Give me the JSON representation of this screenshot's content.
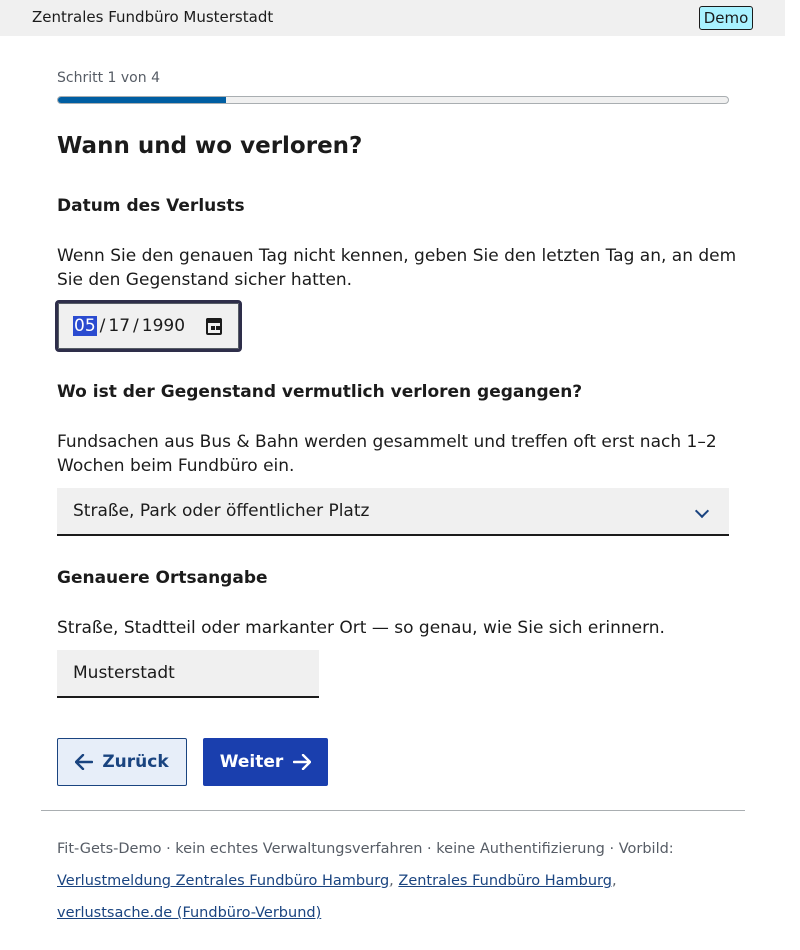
{
  "header": {
    "org_name": "Zentrales Fundbüro Musterstadt",
    "badge": "Demo"
  },
  "progress": {
    "step_text": "Schritt 1 von 4",
    "current_step": 1,
    "total_steps": 4
  },
  "page": {
    "title": "Wann und wo verloren?"
  },
  "date_field": {
    "label": "Datum des Verlusts",
    "hint": "Wenn Sie den genauen Tag nicht kennen, geben Sie den letzten Tag an, an dem Sie den Gegenstand sicher hatten.",
    "month": "05",
    "day": "17",
    "year": "1990",
    "separator": "/"
  },
  "location_field": {
    "label": "Wo ist der Gegenstand vermutlich verloren gegangen?",
    "hint": "Fundsachen aus Bus & Bahn werden gesammelt und treffen oft erst nach 1–2 Wochen beim Fundbüro ein.",
    "selected": "Straße, Park oder öffentlicher Platz"
  },
  "detail_field": {
    "label": "Genauere Ortsangabe",
    "hint": "Straße, Stadtteil oder markanter Ort — so genau, wie Sie sich erinnern.",
    "value": "Musterstadt"
  },
  "actions": {
    "back_label": "Zurück",
    "next_label": "Weiter"
  },
  "footer": {
    "text": "Fit-Gets-Demo · kein echtes Verwaltungsverfahren · keine Authentifizierung · Vorbild:",
    "links": [
      "Verlustmeldung Zentrales Fundbüro Hamburg",
      "Zentrales Fundbüro Hamburg",
      "verlustsache.de (Fundbüro-Verbund)"
    ],
    "link_separator": ","
  },
  "colors": {
    "primary": "#1a3fae",
    "progress_fill": "#005ea2",
    "badge_bg": "#a8f2ff",
    "link": "#1a4480"
  }
}
